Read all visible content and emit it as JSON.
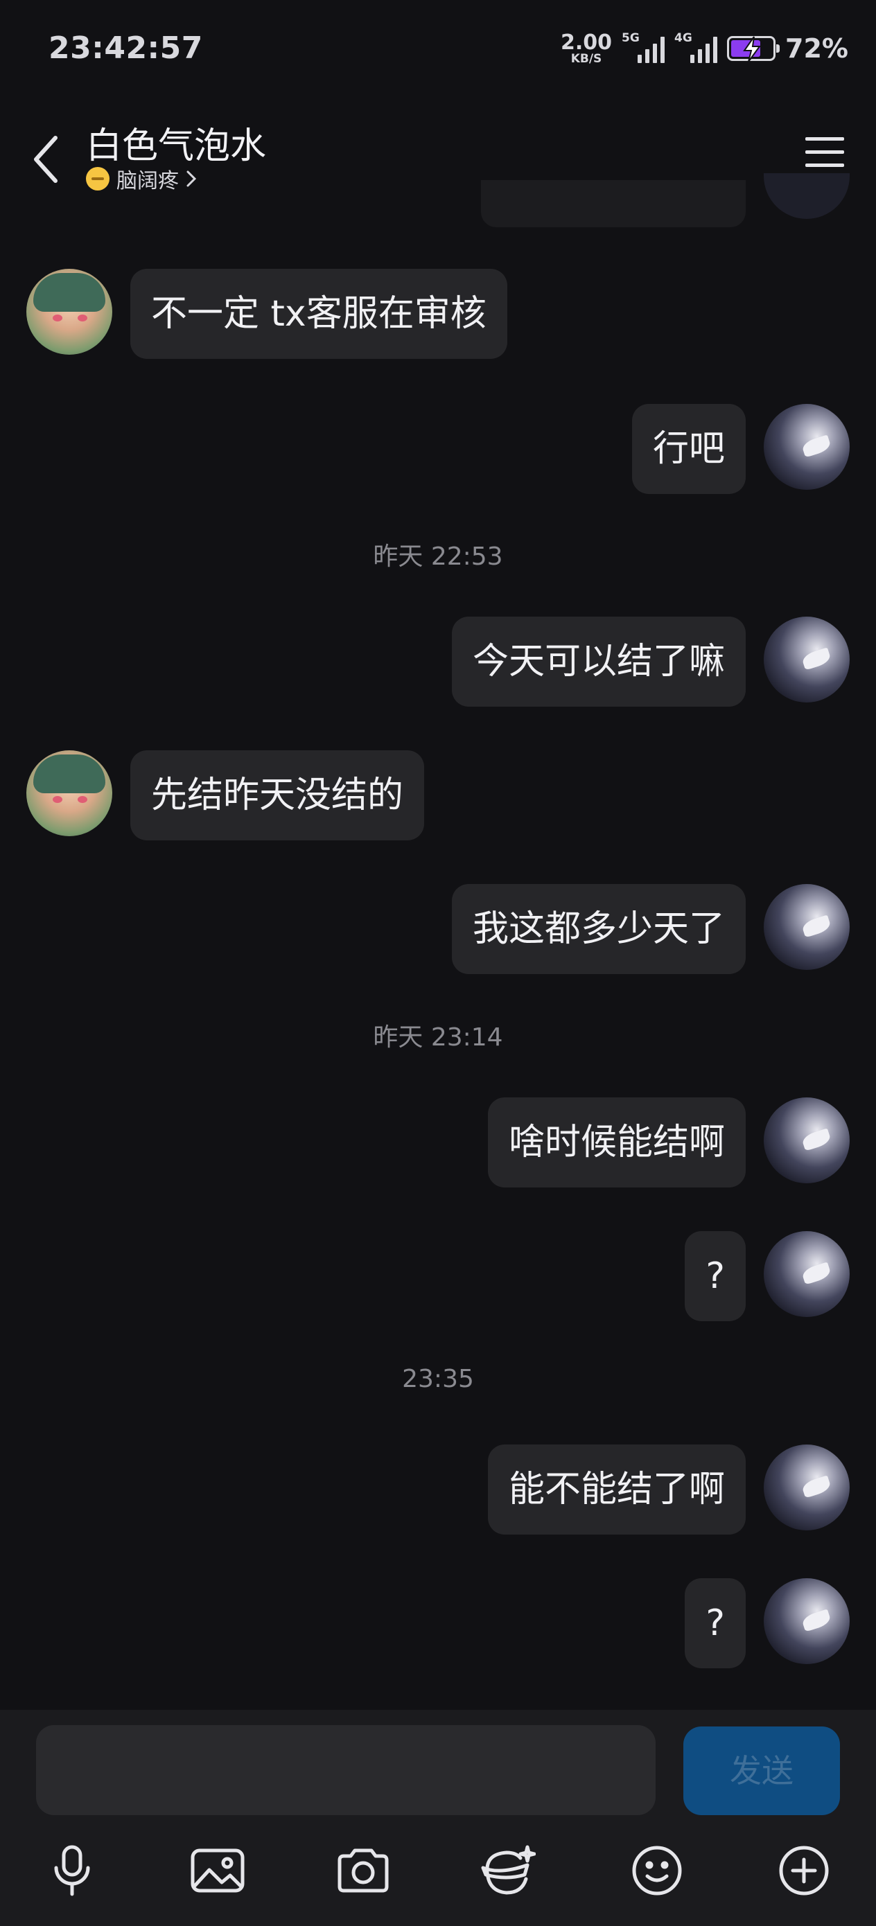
{
  "status_bar": {
    "time": "23:42:57",
    "speed_value": "2.00",
    "speed_unit": "KB/S",
    "signal1_label": "5G",
    "signal2_label": "4G",
    "battery_percent": "72%",
    "battery_level": 0.72,
    "battery_color": "#8b3cf0"
  },
  "header": {
    "contact_name": "白色气泡水",
    "status_text": "脑阔疼",
    "status_icon": "emoji-icon",
    "back_icon": "back-icon",
    "menu_icon": "menu-icon"
  },
  "messages": [
    {
      "side": "left",
      "text": "不一定 tx客服在审核"
    },
    {
      "side": "right",
      "text": "行吧"
    },
    {
      "timestamp": "昨天 22:53"
    },
    {
      "side": "right",
      "text": "今天可以结了嘛"
    },
    {
      "side": "left",
      "text": "先结昨天没结的"
    },
    {
      "side": "right",
      "text": "我这都多少天了"
    },
    {
      "timestamp": "昨天 23:14"
    },
    {
      "side": "right",
      "text": "啥时候能结啊"
    },
    {
      "side": "right",
      "text": "?"
    },
    {
      "timestamp": "23:35"
    },
    {
      "side": "right",
      "text": "能不能结了啊"
    },
    {
      "side": "right",
      "text": "?"
    }
  ],
  "input": {
    "value": "",
    "placeholder": "",
    "send_label": "发送",
    "send_color": "#0f4d82"
  },
  "toolbar": [
    "microphone-icon",
    "image-icon",
    "camera-icon",
    "sticker-icon",
    "emoji-icon",
    "plus-icon"
  ]
}
